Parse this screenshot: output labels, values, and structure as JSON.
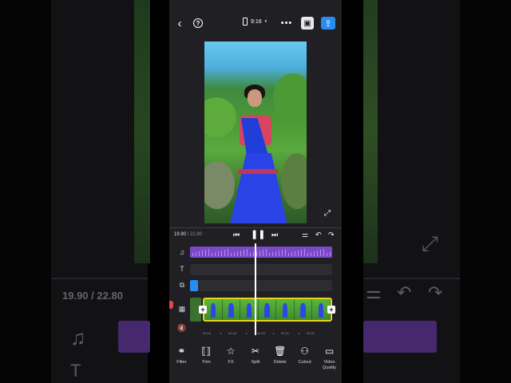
{
  "background": {
    "timecode_current": "19.90",
    "timecode_total": "/ 22.80"
  },
  "topbar": {
    "back_icon": "chevron-left-icon",
    "help_icon": "question-circle-icon",
    "aspect_ratio": "9:16",
    "save_icon": "save-icon",
    "export_icon": "export-icon"
  },
  "preview": {
    "expand_icon": "fullscreen-icon"
  },
  "playback": {
    "current": "19.90",
    "total": "/ 22.80"
  },
  "timeline": {
    "ruler_ticks": [
      "00:16",
      "00:18",
      "00:20",
      "00:21",
      "00:22"
    ]
  },
  "toolbar": {
    "items": [
      {
        "label": "Filter",
        "icon": "filter-icon"
      },
      {
        "label": "Trim",
        "icon": "trim-icon"
      },
      {
        "label": "FX",
        "icon": "star-icon"
      },
      {
        "label": "Split",
        "icon": "scissors-icon"
      },
      {
        "label": "Delete",
        "icon": "trash-icon"
      },
      {
        "label": "Cutout",
        "icon": "cutout-icon"
      },
      {
        "label": "Video Quality",
        "icon": "video-quality-icon"
      }
    ]
  },
  "colors": {
    "accent": "#2a8cf0",
    "music_track": "#7b49c8",
    "clip_border": "#e6d51c",
    "background": "#202024"
  }
}
